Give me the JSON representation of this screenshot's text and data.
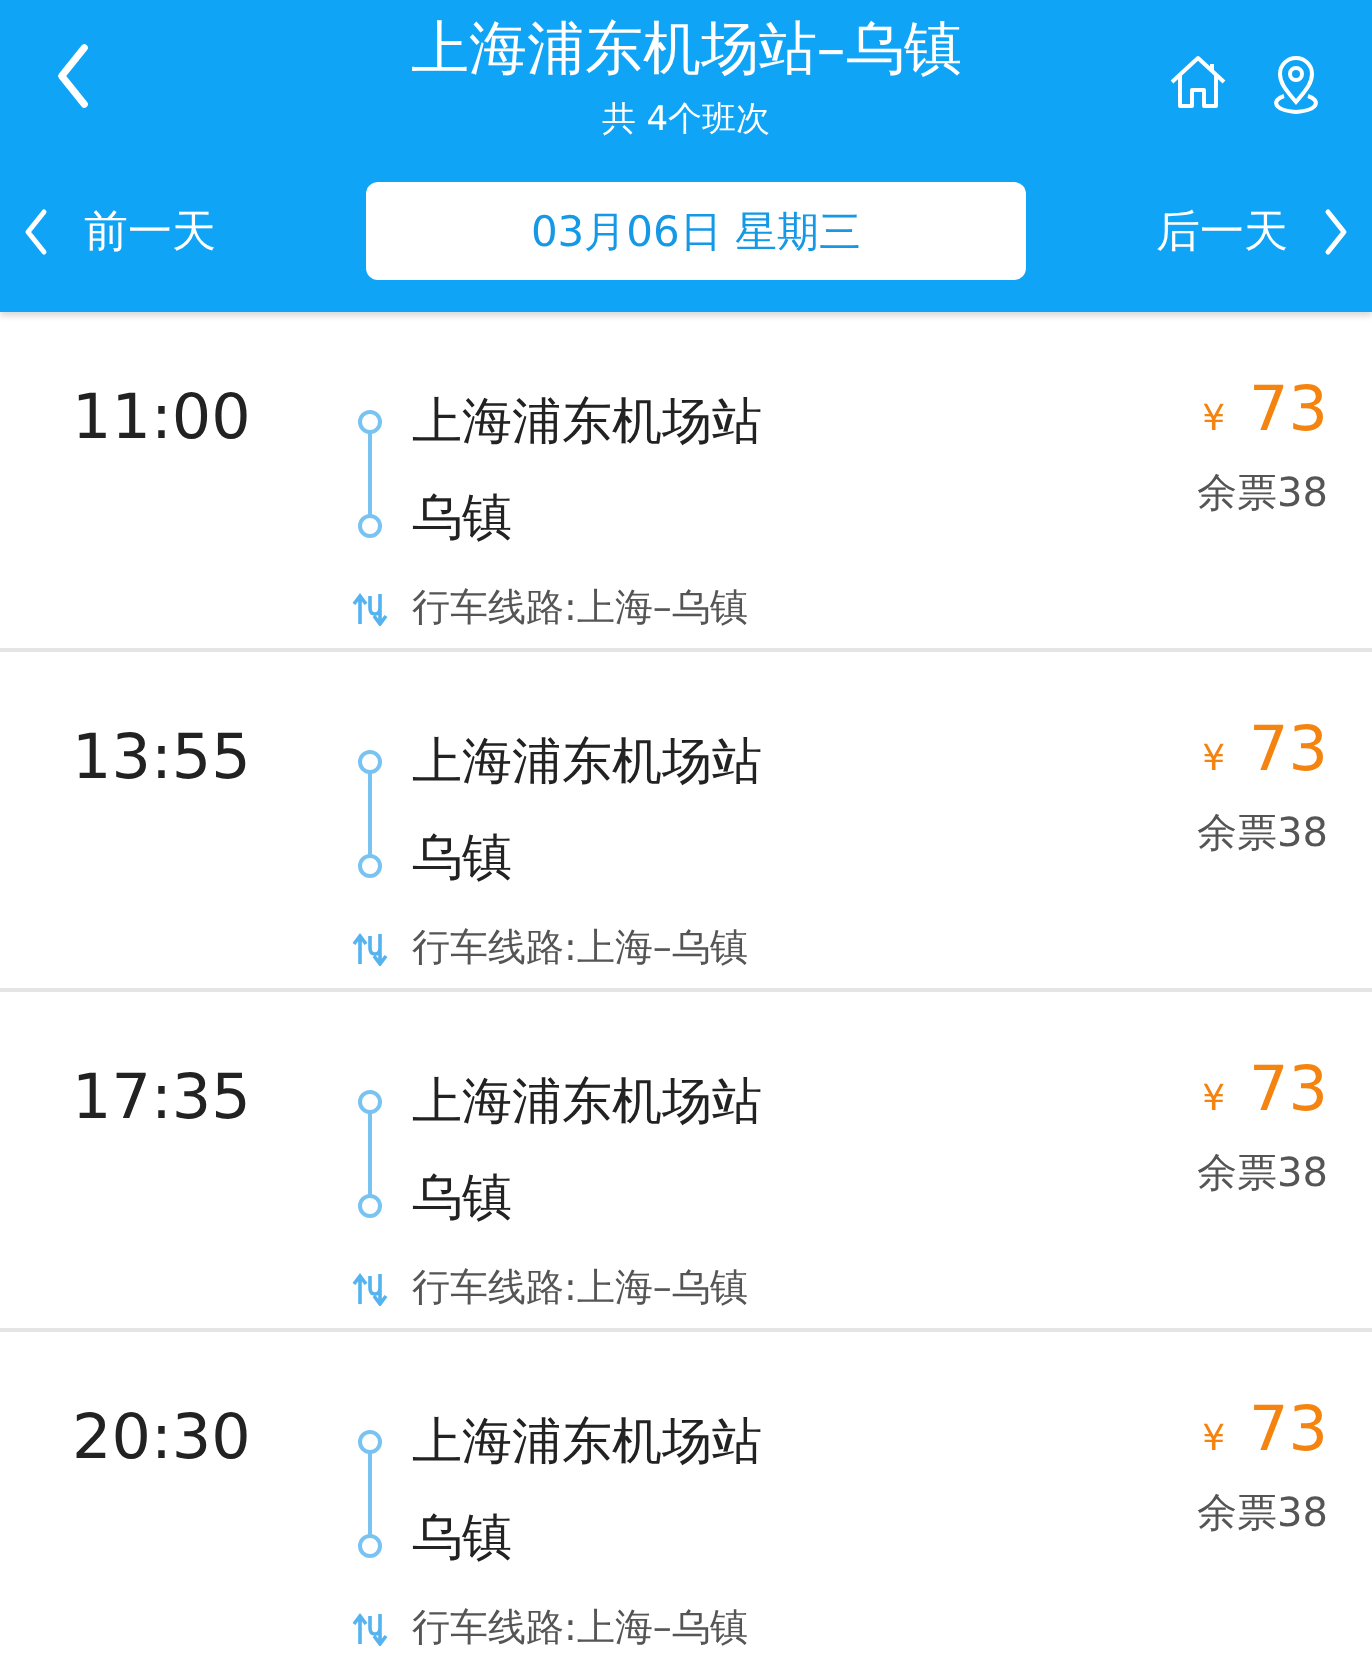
{
  "header": {
    "title": "上海浦东机场站–乌镇",
    "subtitle": "共 4个班次",
    "prev_day": "前一天",
    "date": "03月06日 星期三",
    "next_day": "后一天"
  },
  "trips": [
    {
      "time": "11:00",
      "from": "上海浦东机场站",
      "to": "乌镇",
      "route": "行车线路:上海–乌镇",
      "currency": "¥",
      "price": "73",
      "tickets": "余票38"
    },
    {
      "time": "13:55",
      "from": "上海浦东机场站",
      "to": "乌镇",
      "route": "行车线路:上海–乌镇",
      "currency": "¥",
      "price": "73",
      "tickets": "余票38"
    },
    {
      "time": "17:35",
      "from": "上海浦东机场站",
      "to": "乌镇",
      "route": "行车线路:上海–乌镇",
      "currency": "¥",
      "price": "73",
      "tickets": "余票38"
    },
    {
      "time": "20:30",
      "from": "上海浦东机场站",
      "to": "乌镇",
      "route": "行车线路:上海–乌镇",
      "currency": "¥",
      "price": "73",
      "tickets": "余票38"
    }
  ]
}
